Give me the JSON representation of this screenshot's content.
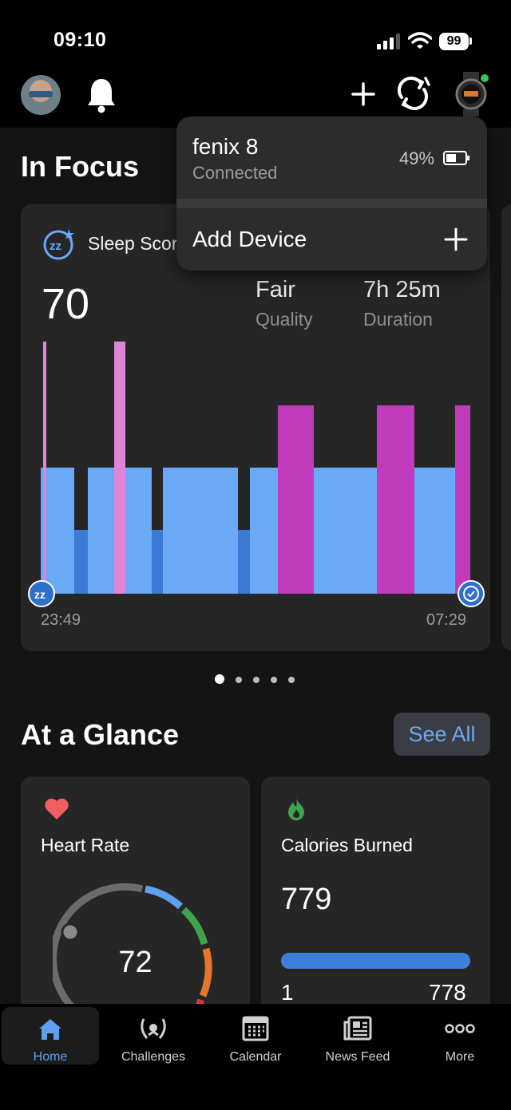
{
  "status_bar": {
    "time": "09:10",
    "battery": "99"
  },
  "header": {
    "avatar_alt": "User avatar"
  },
  "in_focus": {
    "title": "In Focus",
    "sleep_card": {
      "title": "Sleep Score",
      "score": "70",
      "quality_value": "Fair",
      "quality_label": "Quality",
      "duration_value": "7h 25m",
      "duration_label": "Duration",
      "start_time": "23:49",
      "end_time": "07:29",
      "stage_colors": {
        "deep": "#3a7bd5",
        "light": "#6aa9f5",
        "rem": "#c33bbd",
        "awake": "#e084d8"
      }
    },
    "page_dots": 5,
    "active_dot": 0
  },
  "device_dropdown": {
    "device_name": "fenix 8",
    "device_status": "Connected",
    "device_battery": "49%",
    "add_device_label": "Add Device"
  },
  "at_a_glance": {
    "title": "At a Glance",
    "see_all_label": "See All",
    "heart_rate": {
      "title": "Heart Rate",
      "value": "72"
    },
    "calories": {
      "title": "Calories Burned",
      "value": "779",
      "left_value": "1",
      "right_value": "778"
    }
  },
  "tab_bar": {
    "tabs": [
      {
        "label": "Home",
        "icon": "home-icon",
        "active": true
      },
      {
        "label": "Challenges",
        "icon": "laurel-icon",
        "active": false
      },
      {
        "label": "Calendar",
        "icon": "calendar-icon",
        "active": false
      },
      {
        "label": "News Feed",
        "icon": "newspaper-icon",
        "active": false
      },
      {
        "label": "More",
        "icon": "more-icon",
        "active": false
      }
    ]
  }
}
